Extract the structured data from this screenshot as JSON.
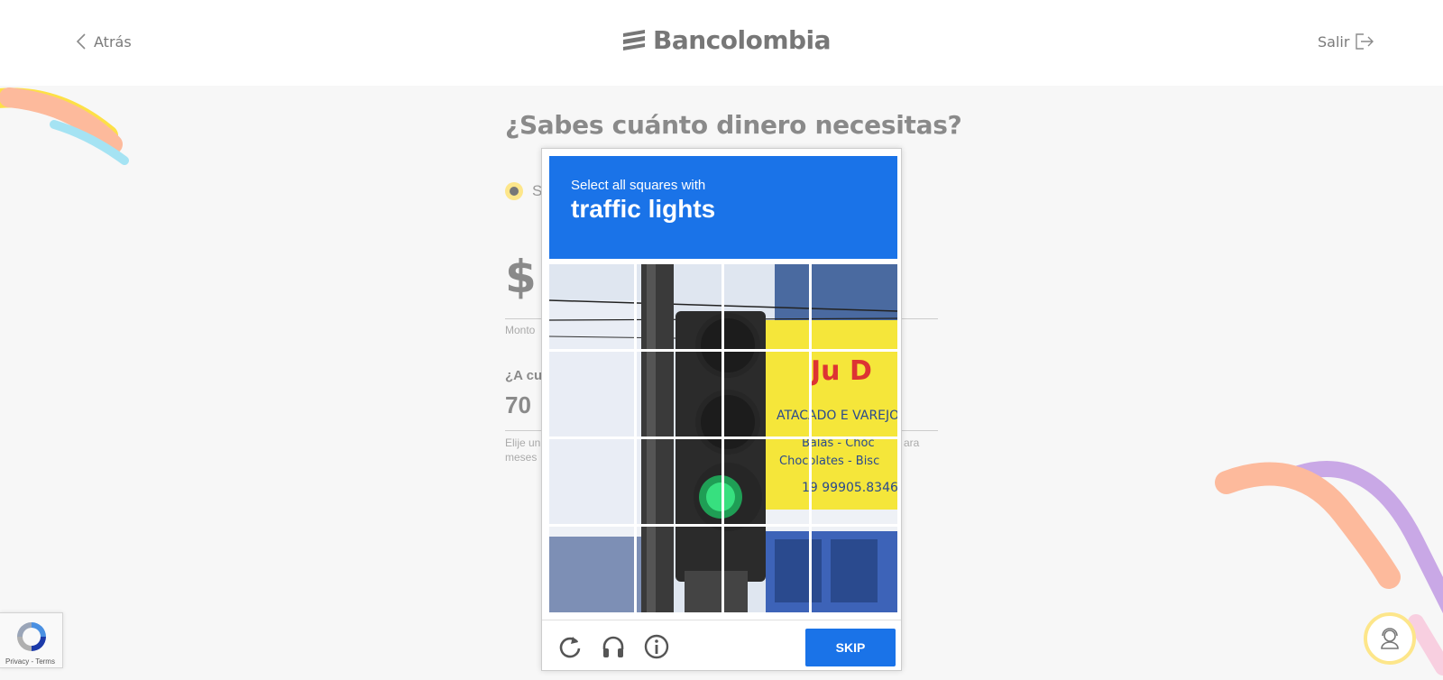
{
  "header": {
    "back_label": "Atrás",
    "brand": "Bancolombia",
    "exit_label": "Salir"
  },
  "form": {
    "title": "¿Sabes cuánto dinero necesitas?",
    "radio_label": "S",
    "amount_prefix": "$",
    "amount_hint": "Monto",
    "months_question": "¿A cu",
    "months_value": "70",
    "months_hint_left": "Elije un",
    "months_hint_left2": "meses",
    "months_hint_right": "ara"
  },
  "captcha": {
    "instruction": "Select all squares with",
    "target": "traffic lights",
    "skip_label": "SKIP",
    "footer_icons": [
      "reload-icon",
      "audio-icon",
      "info-icon"
    ]
  },
  "recaptcha_badge": {
    "links": "Privacy - Terms"
  },
  "colors": {
    "captcha_blue": "#1a73e8",
    "accent_yellow": "#fde68a",
    "brand_gray": "#777777"
  }
}
